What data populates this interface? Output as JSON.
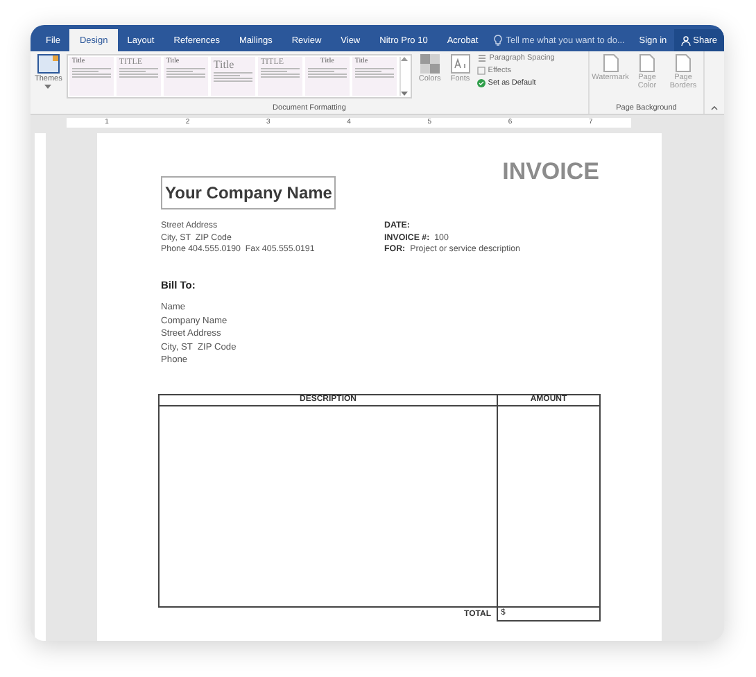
{
  "tabs": [
    {
      "label": "File",
      "selected": false
    },
    {
      "label": "Design",
      "selected": true
    },
    {
      "label": "Layout",
      "selected": false
    },
    {
      "label": "References",
      "selected": false
    },
    {
      "label": "Mailings",
      "selected": false
    },
    {
      "label": "Review",
      "selected": false
    },
    {
      "label": "View",
      "selected": false
    },
    {
      "label": "Nitro Pro 10",
      "selected": false
    },
    {
      "label": "Acrobat",
      "selected": false
    }
  ],
  "tell_me": {
    "placeholder": "Tell me what you want to do..."
  },
  "sign_in": "Sign in",
  "share": "Share",
  "ribbon": {
    "themes": "Themes",
    "gallery": [
      {
        "title": "Title",
        "kind": "small"
      },
      {
        "title": "TITLE",
        "kind": "caps"
      },
      {
        "title": "Title",
        "kind": "small"
      },
      {
        "title": "Title",
        "kind": "large"
      },
      {
        "title": "TITLE",
        "kind": "caps"
      },
      {
        "title": "Title",
        "kind": "centered"
      },
      {
        "title": "Title",
        "kind": "small"
      }
    ],
    "colors": "Colors",
    "fonts": "Fonts",
    "paragraph_spacing": "Paragraph Spacing",
    "effects": "Effects",
    "set_default": "Set as Default",
    "group_1": "Document Formatting",
    "watermark": "Watermark",
    "page_color": "Page Color",
    "page_borders": "Page Borders",
    "group_2": "Page Background"
  },
  "ruler": [
    "1",
    "2",
    "3",
    "4",
    "5",
    "6",
    "7"
  ],
  "document": {
    "company": "Your Company Name",
    "heading": "INVOICE",
    "address": [
      "Street Address",
      "City, ST  ZIP Code",
      "Phone 404.555.0190  Fax 405.555.0191"
    ],
    "fields": [
      {
        "label": "DATE:"
      },
      {
        "label": "INVOICE #:",
        "value": "100"
      },
      {
        "label": "FOR:",
        "value": "Project or service description"
      }
    ],
    "bill_to": "Bill To:",
    "bill_lines": [
      "Name",
      "Company Name",
      "Street Address",
      "City, ST  ZIP Code",
      "Phone"
    ],
    "table": {
      "columns": [
        "DESCRIPTION",
        "AMOUNT"
      ],
      "total_label": "TOTAL",
      "total_value": "$"
    }
  }
}
